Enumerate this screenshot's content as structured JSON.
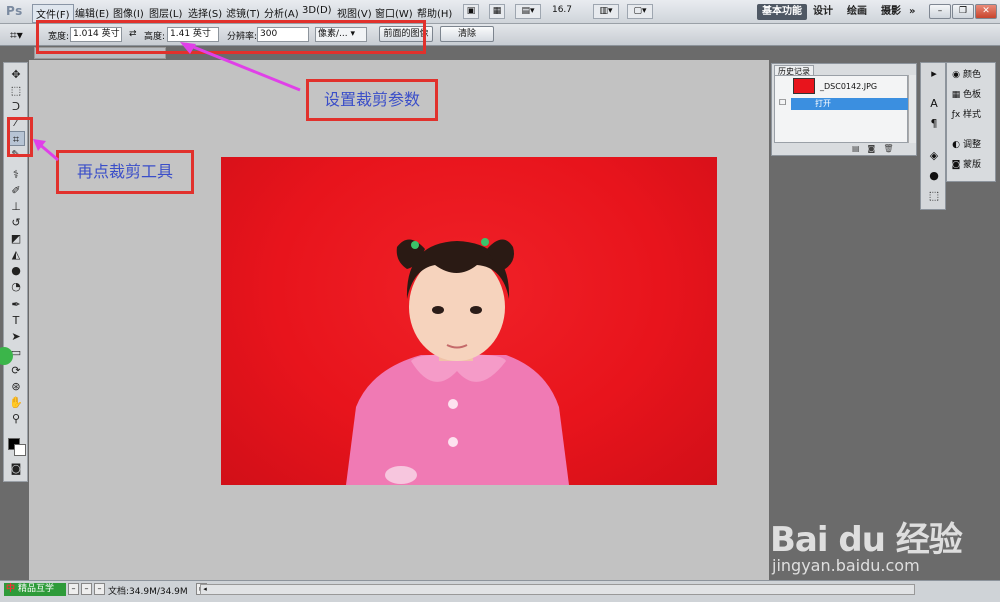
{
  "app": {
    "logo": "Ps"
  },
  "menubar": {
    "items": [
      {
        "label": "文件(F)"
      },
      {
        "label": "编辑(E)"
      },
      {
        "label": "图像(I)"
      },
      {
        "label": "图层(L)"
      },
      {
        "label": "选择(S)"
      },
      {
        "label": "滤镜(T)"
      },
      {
        "label": "分析(A)"
      },
      {
        "label": "3D(D)"
      },
      {
        "label": "视图(V)"
      },
      {
        "label": "窗口(W)"
      },
      {
        "label": "帮助(H)"
      }
    ],
    "zoom": "16.7",
    "workspaces": [
      {
        "label": "基本功能"
      },
      {
        "label": "设计"
      },
      {
        "label": "绘画"
      },
      {
        "label": "摄影"
      }
    ],
    "more": "»"
  },
  "options": {
    "width_label": "宽度:",
    "width_value": "1.014 英寸",
    "height_label": "高度:",
    "height_value": "1.41 英寸",
    "resolution_label": "分辨率:",
    "resolution_value": "300",
    "unit_value": "像素/...",
    "front_image_button": "前面的图像",
    "clear_button": "清除"
  },
  "history": {
    "title": "历史记录",
    "snapshot_name": "_DSC0142.JPG",
    "row_label": "打开"
  },
  "dock": {
    "items": [
      {
        "label": "颜色"
      },
      {
        "label": "色板"
      },
      {
        "label": "样式"
      },
      {
        "label": "调整"
      },
      {
        "label": "蒙版"
      }
    ]
  },
  "status": {
    "badge": "精品互学",
    "badge_cn": "中",
    "doc_size": "文档:34.9M/34.9M"
  },
  "annotations": {
    "set_crop_params": "设置裁剪参数",
    "click_crop_tool": "再点裁剪工具"
  },
  "watermark": {
    "logo": "Bai du 经验",
    "url": "jingyan.baidu.com"
  },
  "colors": {
    "photo_bg": "#e8141c",
    "annotation_red": "#e1312c",
    "arrow_magenta": "#e040e8",
    "callout_text": "#3a4ec9"
  }
}
